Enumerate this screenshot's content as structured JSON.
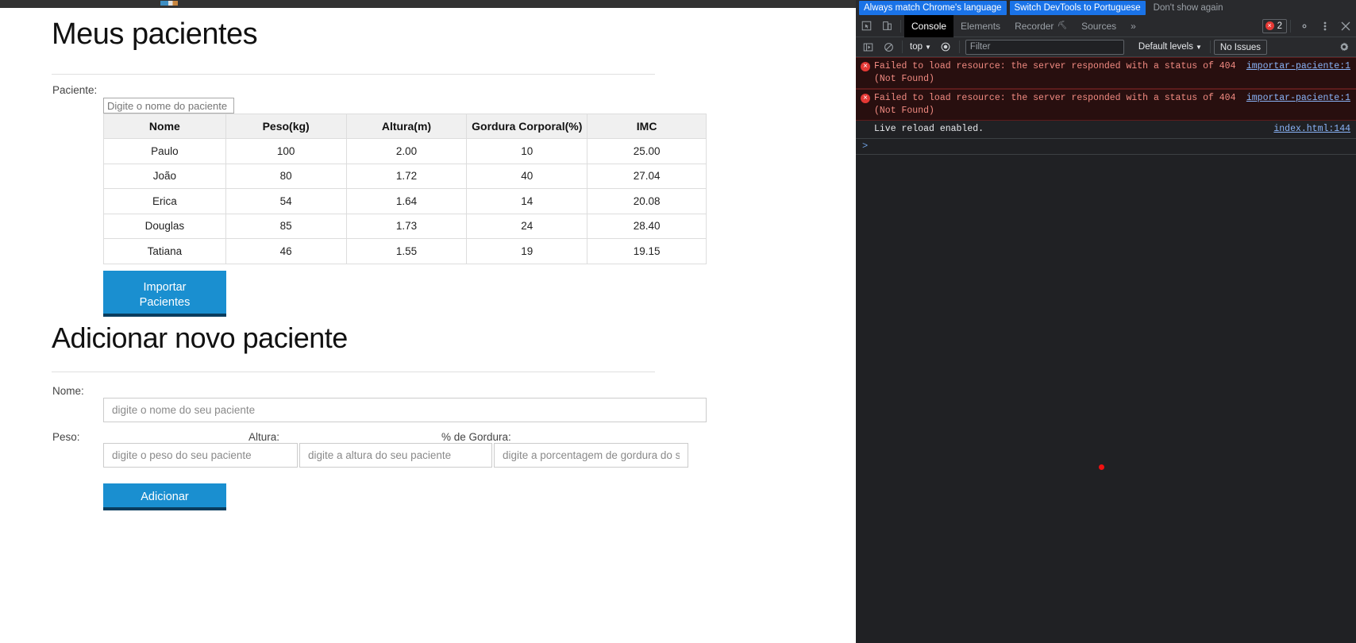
{
  "page": {
    "title_patients": "Meus pacientes",
    "title_add": "Adicionar novo paciente",
    "filter": {
      "label": "Paciente:",
      "placeholder": "Digite o nome do paciente",
      "value": ""
    },
    "table": {
      "columns": [
        "Nome",
        "Peso(kg)",
        "Altura(m)",
        "Gordura Corporal(%)",
        "IMC"
      ],
      "rows": [
        {
          "nome": "Paulo",
          "peso": "100",
          "altura": "2.00",
          "gordura": "10",
          "imc": "25.00"
        },
        {
          "nome": "João",
          "peso": "80",
          "altura": "1.72",
          "gordura": "40",
          "imc": "27.04"
        },
        {
          "nome": "Erica",
          "peso": "54",
          "altura": "1.64",
          "gordura": "14",
          "imc": "20.08"
        },
        {
          "nome": "Douglas",
          "peso": "85",
          "altura": "1.73",
          "gordura": "24",
          "imc": "28.40"
        },
        {
          "nome": "Tatiana",
          "peso": "46",
          "altura": "1.55",
          "gordura": "19",
          "imc": "19.15"
        }
      ]
    },
    "import_button": "Importar Pacientes",
    "import_button_line1": "Importar",
    "import_button_line2": "Pacientes",
    "form": {
      "nome_label": "Nome:",
      "nome_placeholder": "digite o nome do seu paciente",
      "nome_value": "",
      "peso_label": "Peso:",
      "peso_placeholder": "digite o peso do seu paciente",
      "peso_value": "",
      "altura_label": "Altura:",
      "altura_placeholder": "digite a altura do seu paciente",
      "altura_value": "",
      "gordura_label": "% de Gordura:",
      "gordura_placeholder": "digite a porcentagem de gordura do seu paciente",
      "gordura_value": "",
      "submit_label": "Adicionar"
    },
    "accent_color": "#1a8fd0",
    "accent_shadow_color": "#0a3d5e"
  },
  "devtools": {
    "language_banner": {
      "always_match": "Always match Chrome's language",
      "switch": "Switch DevTools to Portuguese",
      "dont_show": "Don't show again"
    },
    "tabs": [
      {
        "label": "Console",
        "active": true
      },
      {
        "label": "Elements",
        "active": false
      },
      {
        "label": "Recorder",
        "active": false,
        "badge": "⛏"
      },
      {
        "label": "Sources",
        "active": false
      }
    ],
    "more_tabs": "»",
    "error_count": "2",
    "toolbar": {
      "context": "top",
      "filter_placeholder": "Filter",
      "filter_value": "",
      "levels": "Default levels",
      "issues": "No Issues"
    },
    "console_entries": [
      {
        "type": "error",
        "text": "Failed to load resource: the server responded with a status of 404 (Not Found)",
        "source": "importar-paciente:1"
      },
      {
        "type": "error",
        "text": "Failed to load resource: the server responded with a status of 404 (Not Found)",
        "source": "importar-paciente:1"
      },
      {
        "type": "info",
        "text": "Live reload enabled.",
        "source": "index.html:144"
      }
    ],
    "prompt": ">",
    "error_color": "#e53935",
    "link_color": "#8ab4f8",
    "accent_color": "#1a73e8"
  }
}
